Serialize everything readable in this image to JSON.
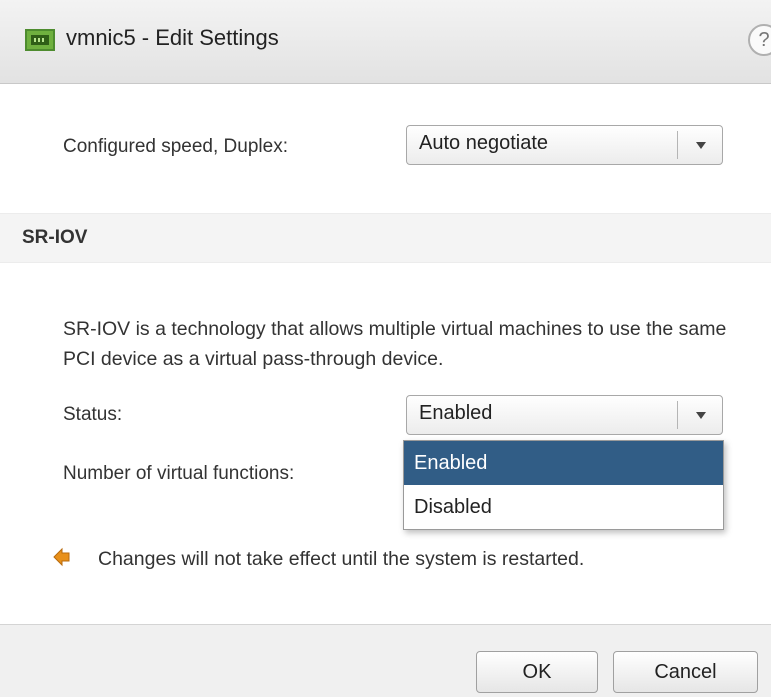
{
  "window": {
    "title": "vmnic5 - Edit Settings",
    "help_label": "?",
    "title_icon": "network-adapter-icon"
  },
  "speed": {
    "label": "Configured speed, Duplex:",
    "value": "Auto negotiate"
  },
  "sriov": {
    "section_title": "SR-IOV",
    "description": "SR-IOV is a technology that allows multiple virtual machines to use the same PCI device as a virtual pass-through device.",
    "status_label": "Status:",
    "status_value": "Enabled",
    "status_options": [
      "Enabled",
      "Disabled"
    ],
    "selected_option_index": 0,
    "vf_label": "Number of virtual functions:"
  },
  "notice": {
    "icon": "warning-arrow-icon",
    "text": "Changes will not take effect until the system is restarted."
  },
  "footer": {
    "ok_label": "OK",
    "cancel_label": "Cancel"
  },
  "colors": {
    "selected_option_bg": "#315d86",
    "warn_icon": "#e8901a"
  }
}
